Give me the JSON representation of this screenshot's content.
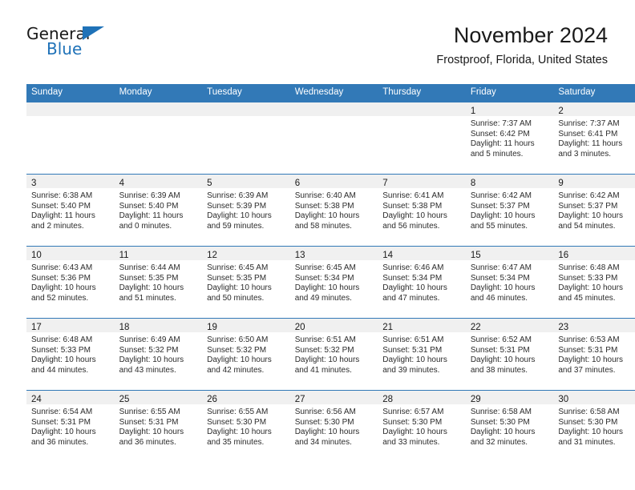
{
  "brand": {
    "name_part1": "General",
    "name_part2": "Blue",
    "accent_color": "#1f72b8",
    "triangle_icon": "triangle-icon"
  },
  "header": {
    "title": "November 2024",
    "subtitle": "Frostproof, Florida, United States"
  },
  "theme": {
    "header_row_bg": "#3279b7",
    "daynum_band_bg": "#f0f0f0",
    "text_color": "#1a1a1a"
  },
  "calendar": {
    "weekday_headers": [
      "Sunday",
      "Monday",
      "Tuesday",
      "Wednesday",
      "Thursday",
      "Friday",
      "Saturday"
    ],
    "weeks": [
      [
        {
          "day": "",
          "empty": true
        },
        {
          "day": "",
          "empty": true
        },
        {
          "day": "",
          "empty": true
        },
        {
          "day": "",
          "empty": true
        },
        {
          "day": "",
          "empty": true
        },
        {
          "day": "1",
          "sunrise": "Sunrise: 7:37 AM",
          "sunset": "Sunset: 6:42 PM",
          "daylight1": "Daylight: 11 hours",
          "daylight2": "and 5 minutes."
        },
        {
          "day": "2",
          "sunrise": "Sunrise: 7:37 AM",
          "sunset": "Sunset: 6:41 PM",
          "daylight1": "Daylight: 11 hours",
          "daylight2": "and 3 minutes."
        }
      ],
      [
        {
          "day": "3",
          "sunrise": "Sunrise: 6:38 AM",
          "sunset": "Sunset: 5:40 PM",
          "daylight1": "Daylight: 11 hours",
          "daylight2": "and 2 minutes."
        },
        {
          "day": "4",
          "sunrise": "Sunrise: 6:39 AM",
          "sunset": "Sunset: 5:40 PM",
          "daylight1": "Daylight: 11 hours",
          "daylight2": "and 0 minutes."
        },
        {
          "day": "5",
          "sunrise": "Sunrise: 6:39 AM",
          "sunset": "Sunset: 5:39 PM",
          "daylight1": "Daylight: 10 hours",
          "daylight2": "and 59 minutes."
        },
        {
          "day": "6",
          "sunrise": "Sunrise: 6:40 AM",
          "sunset": "Sunset: 5:38 PM",
          "daylight1": "Daylight: 10 hours",
          "daylight2": "and 58 minutes."
        },
        {
          "day": "7",
          "sunrise": "Sunrise: 6:41 AM",
          "sunset": "Sunset: 5:38 PM",
          "daylight1": "Daylight: 10 hours",
          "daylight2": "and 56 minutes."
        },
        {
          "day": "8",
          "sunrise": "Sunrise: 6:42 AM",
          "sunset": "Sunset: 5:37 PM",
          "daylight1": "Daylight: 10 hours",
          "daylight2": "and 55 minutes."
        },
        {
          "day": "9",
          "sunrise": "Sunrise: 6:42 AM",
          "sunset": "Sunset: 5:37 PM",
          "daylight1": "Daylight: 10 hours",
          "daylight2": "and 54 minutes."
        }
      ],
      [
        {
          "day": "10",
          "sunrise": "Sunrise: 6:43 AM",
          "sunset": "Sunset: 5:36 PM",
          "daylight1": "Daylight: 10 hours",
          "daylight2": "and 52 minutes."
        },
        {
          "day": "11",
          "sunrise": "Sunrise: 6:44 AM",
          "sunset": "Sunset: 5:35 PM",
          "daylight1": "Daylight: 10 hours",
          "daylight2": "and 51 minutes."
        },
        {
          "day": "12",
          "sunrise": "Sunrise: 6:45 AM",
          "sunset": "Sunset: 5:35 PM",
          "daylight1": "Daylight: 10 hours",
          "daylight2": "and 50 minutes."
        },
        {
          "day": "13",
          "sunrise": "Sunrise: 6:45 AM",
          "sunset": "Sunset: 5:34 PM",
          "daylight1": "Daylight: 10 hours",
          "daylight2": "and 49 minutes."
        },
        {
          "day": "14",
          "sunrise": "Sunrise: 6:46 AM",
          "sunset": "Sunset: 5:34 PM",
          "daylight1": "Daylight: 10 hours",
          "daylight2": "and 47 minutes."
        },
        {
          "day": "15",
          "sunrise": "Sunrise: 6:47 AM",
          "sunset": "Sunset: 5:34 PM",
          "daylight1": "Daylight: 10 hours",
          "daylight2": "and 46 minutes."
        },
        {
          "day": "16",
          "sunrise": "Sunrise: 6:48 AM",
          "sunset": "Sunset: 5:33 PM",
          "daylight1": "Daylight: 10 hours",
          "daylight2": "and 45 minutes."
        }
      ],
      [
        {
          "day": "17",
          "sunrise": "Sunrise: 6:48 AM",
          "sunset": "Sunset: 5:33 PM",
          "daylight1": "Daylight: 10 hours",
          "daylight2": "and 44 minutes."
        },
        {
          "day": "18",
          "sunrise": "Sunrise: 6:49 AM",
          "sunset": "Sunset: 5:32 PM",
          "daylight1": "Daylight: 10 hours",
          "daylight2": "and 43 minutes."
        },
        {
          "day": "19",
          "sunrise": "Sunrise: 6:50 AM",
          "sunset": "Sunset: 5:32 PM",
          "daylight1": "Daylight: 10 hours",
          "daylight2": "and 42 minutes."
        },
        {
          "day": "20",
          "sunrise": "Sunrise: 6:51 AM",
          "sunset": "Sunset: 5:32 PM",
          "daylight1": "Daylight: 10 hours",
          "daylight2": "and 41 minutes."
        },
        {
          "day": "21",
          "sunrise": "Sunrise: 6:51 AM",
          "sunset": "Sunset: 5:31 PM",
          "daylight1": "Daylight: 10 hours",
          "daylight2": "and 39 minutes."
        },
        {
          "day": "22",
          "sunrise": "Sunrise: 6:52 AM",
          "sunset": "Sunset: 5:31 PM",
          "daylight1": "Daylight: 10 hours",
          "daylight2": "and 38 minutes."
        },
        {
          "day": "23",
          "sunrise": "Sunrise: 6:53 AM",
          "sunset": "Sunset: 5:31 PM",
          "daylight1": "Daylight: 10 hours",
          "daylight2": "and 37 minutes."
        }
      ],
      [
        {
          "day": "24",
          "sunrise": "Sunrise: 6:54 AM",
          "sunset": "Sunset: 5:31 PM",
          "daylight1": "Daylight: 10 hours",
          "daylight2": "and 36 minutes."
        },
        {
          "day": "25",
          "sunrise": "Sunrise: 6:55 AM",
          "sunset": "Sunset: 5:31 PM",
          "daylight1": "Daylight: 10 hours",
          "daylight2": "and 36 minutes."
        },
        {
          "day": "26",
          "sunrise": "Sunrise: 6:55 AM",
          "sunset": "Sunset: 5:30 PM",
          "daylight1": "Daylight: 10 hours",
          "daylight2": "and 35 minutes."
        },
        {
          "day": "27",
          "sunrise": "Sunrise: 6:56 AM",
          "sunset": "Sunset: 5:30 PM",
          "daylight1": "Daylight: 10 hours",
          "daylight2": "and 34 minutes."
        },
        {
          "day": "28",
          "sunrise": "Sunrise: 6:57 AM",
          "sunset": "Sunset: 5:30 PM",
          "daylight1": "Daylight: 10 hours",
          "daylight2": "and 33 minutes."
        },
        {
          "day": "29",
          "sunrise": "Sunrise: 6:58 AM",
          "sunset": "Sunset: 5:30 PM",
          "daylight1": "Daylight: 10 hours",
          "daylight2": "and 32 minutes."
        },
        {
          "day": "30",
          "sunrise": "Sunrise: 6:58 AM",
          "sunset": "Sunset: 5:30 PM",
          "daylight1": "Daylight: 10 hours",
          "daylight2": "and 31 minutes."
        }
      ]
    ]
  }
}
